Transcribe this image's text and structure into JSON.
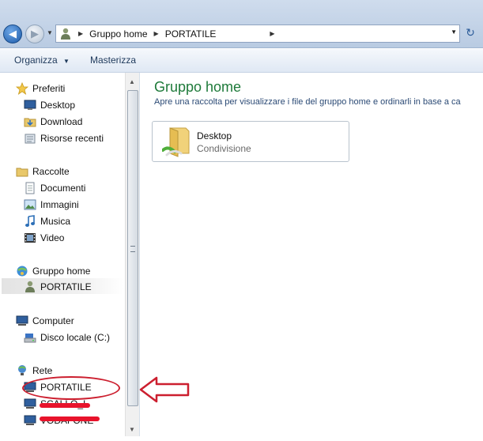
{
  "address": {
    "breadcrumbs": [
      "Gruppo home",
      "PORTATILE"
    ]
  },
  "toolbar": {
    "organize_label": "Organizza",
    "burn_label": "Masterizza"
  },
  "sidebar": {
    "favorites": {
      "label": "Preferiti",
      "items": [
        {
          "label": "Desktop",
          "icon": "desktop-icon"
        },
        {
          "label": "Download",
          "icon": "download-folder-icon"
        },
        {
          "label": "Risorse recenti",
          "icon": "recent-places-icon"
        }
      ]
    },
    "libraries": {
      "label": "Raccolte",
      "items": [
        {
          "label": "Documenti",
          "icon": "documents-icon"
        },
        {
          "label": "Immagini",
          "icon": "pictures-icon"
        },
        {
          "label": "Musica",
          "icon": "music-icon"
        },
        {
          "label": "Video",
          "icon": "video-icon"
        }
      ]
    },
    "homegroup": {
      "label": "Gruppo home",
      "items": [
        {
          "label": "PORTATILE",
          "icon": "user-icon",
          "selected": true
        }
      ]
    },
    "computer": {
      "label": "Computer",
      "items": [
        {
          "label": "Disco locale (C:)",
          "icon": "drive-icon"
        }
      ]
    },
    "network": {
      "label": "Rete",
      "items": [
        {
          "label": "PORTATILE",
          "icon": "network-computer-icon"
        },
        {
          "label": "SCALLO_I",
          "icon": "network-computer-icon"
        },
        {
          "label": "VODAFONE",
          "icon": "network-computer-icon"
        }
      ]
    }
  },
  "main": {
    "title": "Gruppo home",
    "description": "Apre una raccolta per visualizzare i file del gruppo home e ordinarli in base a ca",
    "shares": [
      {
        "name": "Desktop",
        "subtitle": "Condivisione"
      }
    ]
  },
  "colors": {
    "title_green": "#1e7a3a",
    "annotation_red": "#cc1f2f"
  }
}
